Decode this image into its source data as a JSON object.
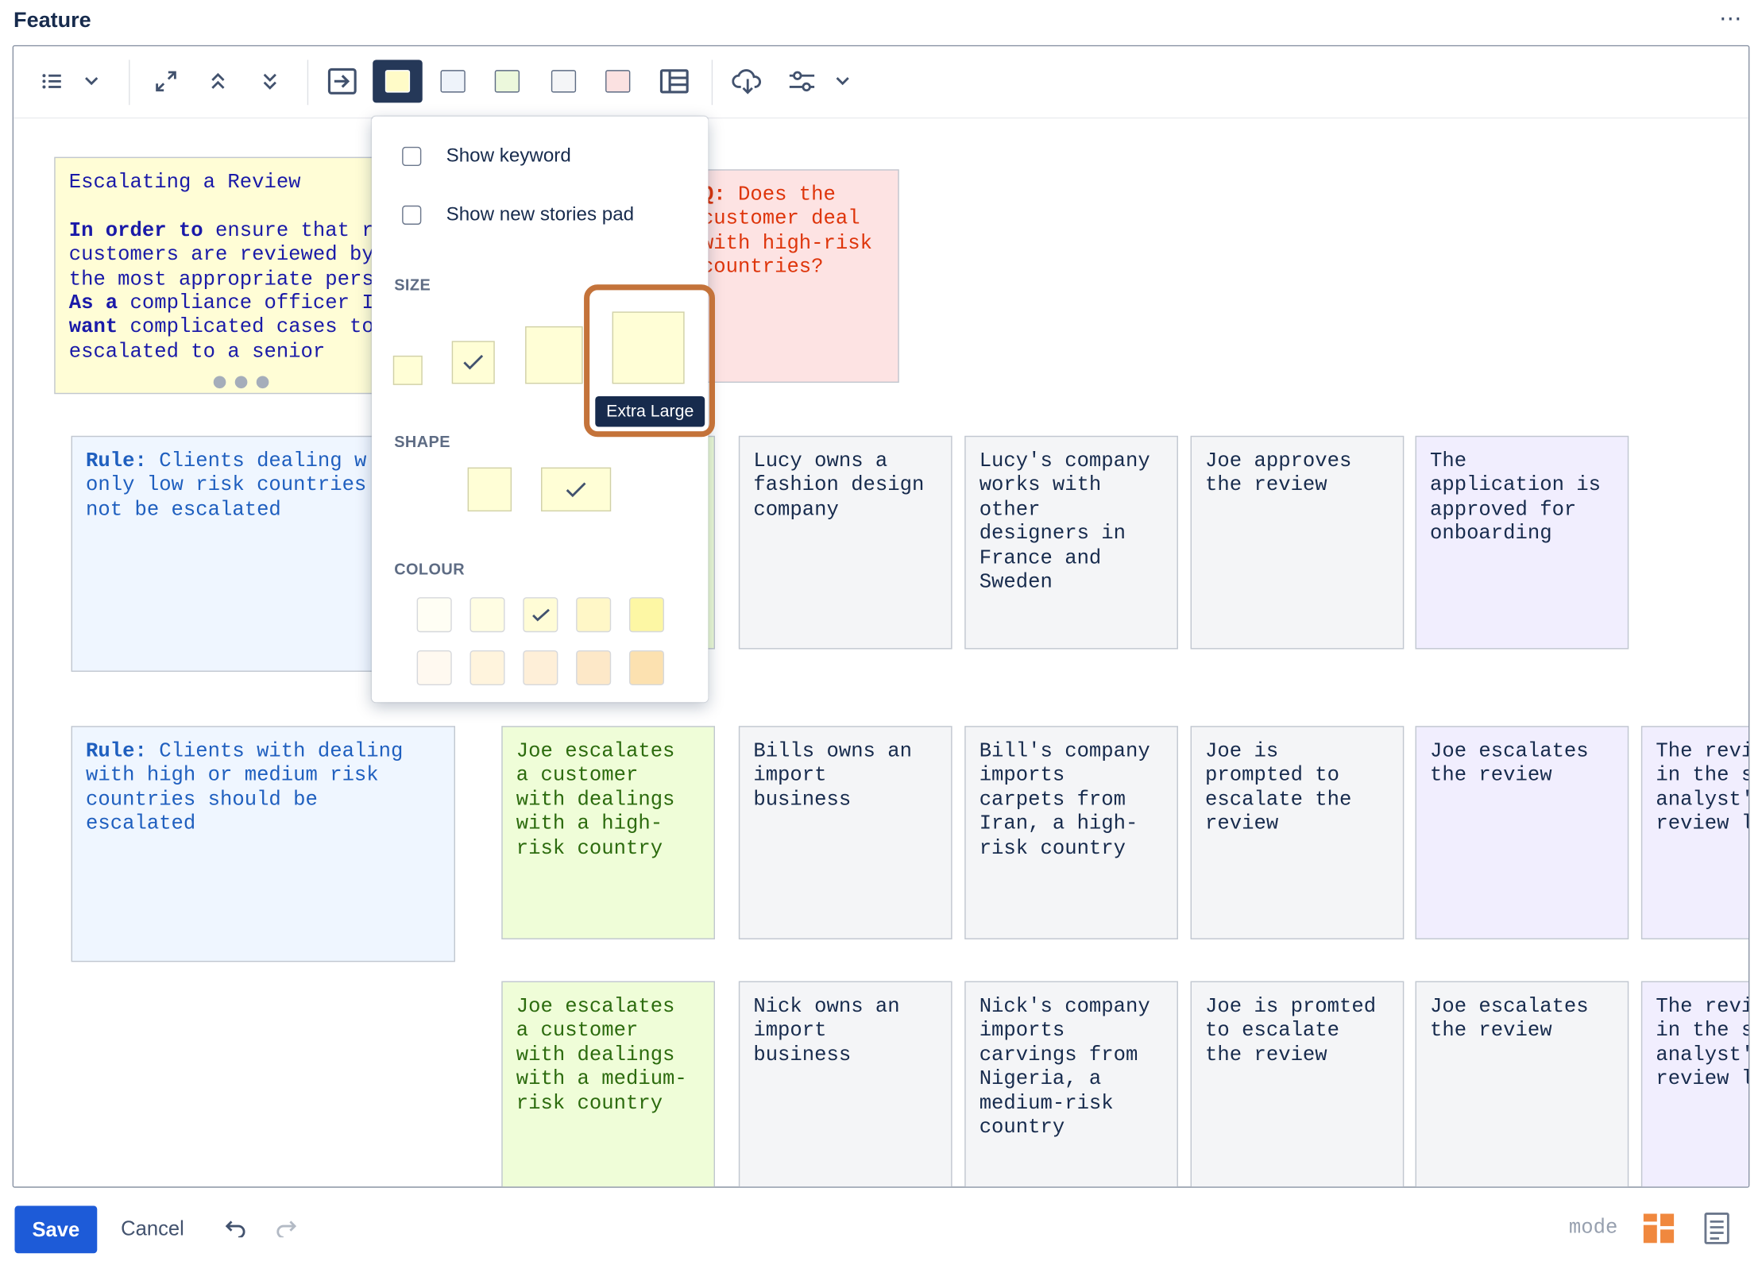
{
  "header": {
    "title": "Feature",
    "more_label": "⋯"
  },
  "toolbar": {
    "buttons": [
      "list-icon",
      "chevron-down-icon",
      "expand-icon",
      "collapse-up-icon",
      "collapse-down-icon",
      "export-icon",
      "card-yellow-icon",
      "card-blue-icon",
      "card-green-icon",
      "card-grey-icon",
      "card-red-icon",
      "table-icon",
      "cloud-download-icon",
      "settings-sliders-icon",
      "chevron-down-icon"
    ]
  },
  "menu": {
    "show_keyword": "Show keyword",
    "show_new_stories_pad": "Show new stories pad",
    "size_heading": "SIZE",
    "shape_heading": "SHAPE",
    "colour_heading": "COLOUR",
    "tooltip": "Extra Large",
    "colours_row1": [
      "#fffef4",
      "#fffde3",
      "#fffcd6",
      "#fff7c7",
      "#fdf7a4"
    ],
    "colours_row2": [
      "#fff9f0",
      "#fff4dd",
      "#feefd8",
      "#fde8c8",
      "#fce1b0"
    ]
  },
  "cards": {
    "feature": {
      "title": "Escalating a Review",
      "l1_kw": "In order to",
      "l1": " ensure that r",
      "l2": "customers are reviewed by",
      "l3": "the most appropriate pers",
      "l4_kw": "As a",
      "l4": " compliance officer I",
      "l5_kw": "want",
      "l5": " complicated cases to",
      "l6": "escalated to a senior"
    },
    "question": {
      "kw": "Q:",
      "text": " Does the\ncustomer deal\nwith high-risk\ncountries?"
    },
    "rule1": {
      "kw": "Rule:",
      "text": " Clients dealing w\nonly low risk countries\nnot be escalated"
    },
    "rule2": {
      "kw": "Rule:",
      "text": " Clients with dealing\nwith high or medium risk\ncountries should be\nescalated"
    },
    "r1": [
      "Lucy owns a\nfashion design\ncompany",
      "Lucy's company\nworks with\nother\ndesigners in\nFrance and\nSweden",
      "Joe approves\nthe review",
      "The\napplication is\napproved for\nonboarding"
    ],
    "r2": [
      "Joe escalates\na customer\nwith dealings\nwith a high-\nrisk country",
      "Bills owns an\nimport\nbusiness",
      "Bill's company\nimports\ncarpets from\nIran, a high-\nrisk country",
      "Joe is\nprompted to\nescalate the\nreview",
      "Joe escalates\nthe review",
      "The revi\nin the s\nanalyst'\nreview l"
    ],
    "r3": [
      "Joe escalates\na customer\nwith dealings\nwith a medium-\nrisk country",
      "Nick owns an\nimport\nbusiness",
      "Nick's company\nimports\ncarvings from\nNigeria, a\nmedium-risk\ncountry",
      "Joe is promted\nto escalate\nthe review",
      "Joe escalates\nthe review",
      "The revi\nin the s\nanalyst'\nreview l"
    ]
  },
  "footer": {
    "save": "Save",
    "cancel": "Cancel",
    "mode": "mode"
  }
}
